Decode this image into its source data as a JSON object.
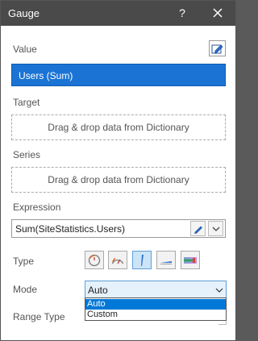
{
  "window": {
    "title": "Gauge",
    "help_label": "?"
  },
  "value_section": {
    "label": "Value",
    "selected": "Users (Sum)"
  },
  "target_section": {
    "label": "Target",
    "placeholder": "Drag & drop data from Dictionary"
  },
  "series_section": {
    "label": "Series",
    "placeholder": "Drag & drop data from Dictionary"
  },
  "expression_section": {
    "label": "Expression",
    "value": "Sum(SiteStatistics.Users)"
  },
  "type_section": {
    "label": "Type",
    "options": [
      "full-circular-gauge-icon",
      "half-circular-gauge-icon",
      "linear-gauge-icon",
      "horizontal-linear-gauge-icon",
      "bullet-gauge-icon"
    ],
    "selected": "linear-gauge-icon"
  },
  "mode_section": {
    "label": "Mode",
    "value": "Auto",
    "options": [
      "Auto",
      "Custom"
    ],
    "highlighted": "Auto"
  },
  "range_type_section": {
    "label": "Range Type"
  },
  "colors": {
    "title_bar": "#4a4a4a",
    "accent": "#1b74d4",
    "highlight": "#0078d7"
  }
}
